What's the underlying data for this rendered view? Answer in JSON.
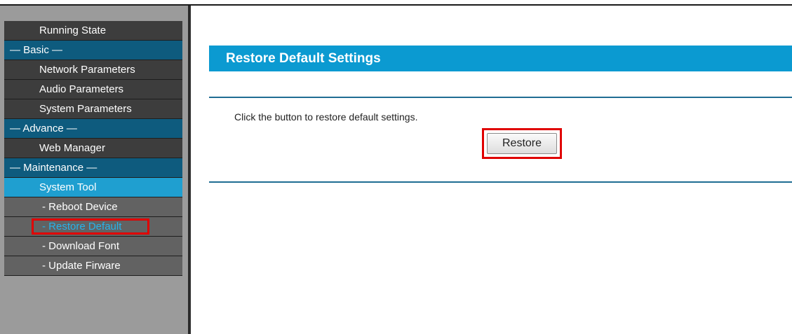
{
  "sidebar": {
    "items": [
      {
        "label": "Running State"
      },
      {
        "label": "— Basic —"
      },
      {
        "label": "Network Parameters"
      },
      {
        "label": "Audio Parameters"
      },
      {
        "label": "System Parameters"
      },
      {
        "label": "— Advance —"
      },
      {
        "label": "Web Manager"
      },
      {
        "label": "— Maintenance —"
      },
      {
        "label": "System Tool"
      },
      {
        "label": "- Reboot Device"
      },
      {
        "label": "- Restore Default"
      },
      {
        "label": "- Download Font"
      },
      {
        "label": "- Update Firware"
      }
    ]
  },
  "main": {
    "title": "Restore Default Settings",
    "description": "Click the button to restore default settings.",
    "restore_label": "Restore"
  },
  "colors": {
    "accent": "#0b9ad1",
    "section": "#0e5b7e",
    "highlight": "#e00000"
  }
}
